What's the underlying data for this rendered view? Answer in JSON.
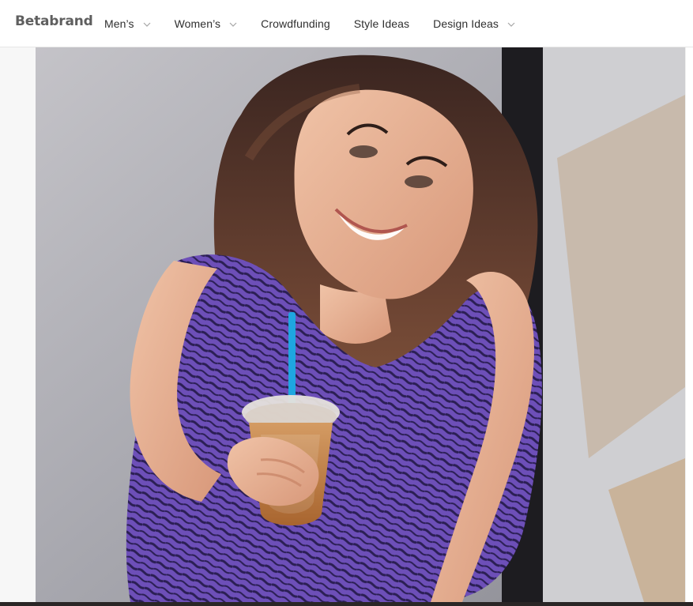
{
  "brand": {
    "logo_text": "Betabrand"
  },
  "nav": {
    "items": [
      {
        "label": "Men’s",
        "has_dropdown": true
      },
      {
        "label": "Women’s",
        "has_dropdown": true
      },
      {
        "label": "Crowdfunding",
        "has_dropdown": false
      },
      {
        "label": "Style Ideas",
        "has_dropdown": false
      },
      {
        "label": "Design Ideas",
        "has_dropdown": true
      }
    ]
  },
  "icons": {
    "chevron": "chevron-down-icon"
  },
  "colors": {
    "header_bg": "#ffffff",
    "text": "#2f2f2f",
    "logo": "#5f5f5f",
    "dress_purple": "#6b4fb6",
    "straw_blue": "#1ea6e0",
    "coffee": "#b77a3d"
  }
}
